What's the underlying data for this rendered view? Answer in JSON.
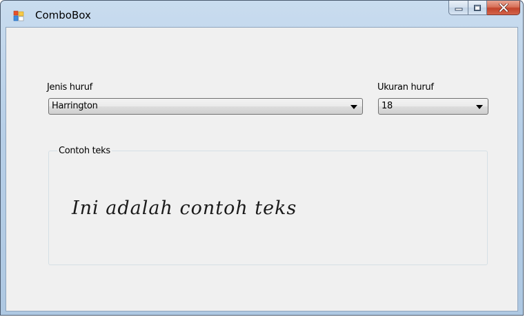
{
  "window": {
    "title": "ComboBox",
    "icon": "winforms-app-icon",
    "controls": {
      "minimize": "minimize-icon",
      "maximize": "maximize-icon",
      "close": "close-icon"
    }
  },
  "font_family": {
    "label": "Jenis huruf",
    "selected": "Harrington"
  },
  "font_size": {
    "label": "Ukuran huruf",
    "selected": "18"
  },
  "sample_group": {
    "legend": "Contoh teks",
    "text": "Ini adalah contoh teks"
  }
}
